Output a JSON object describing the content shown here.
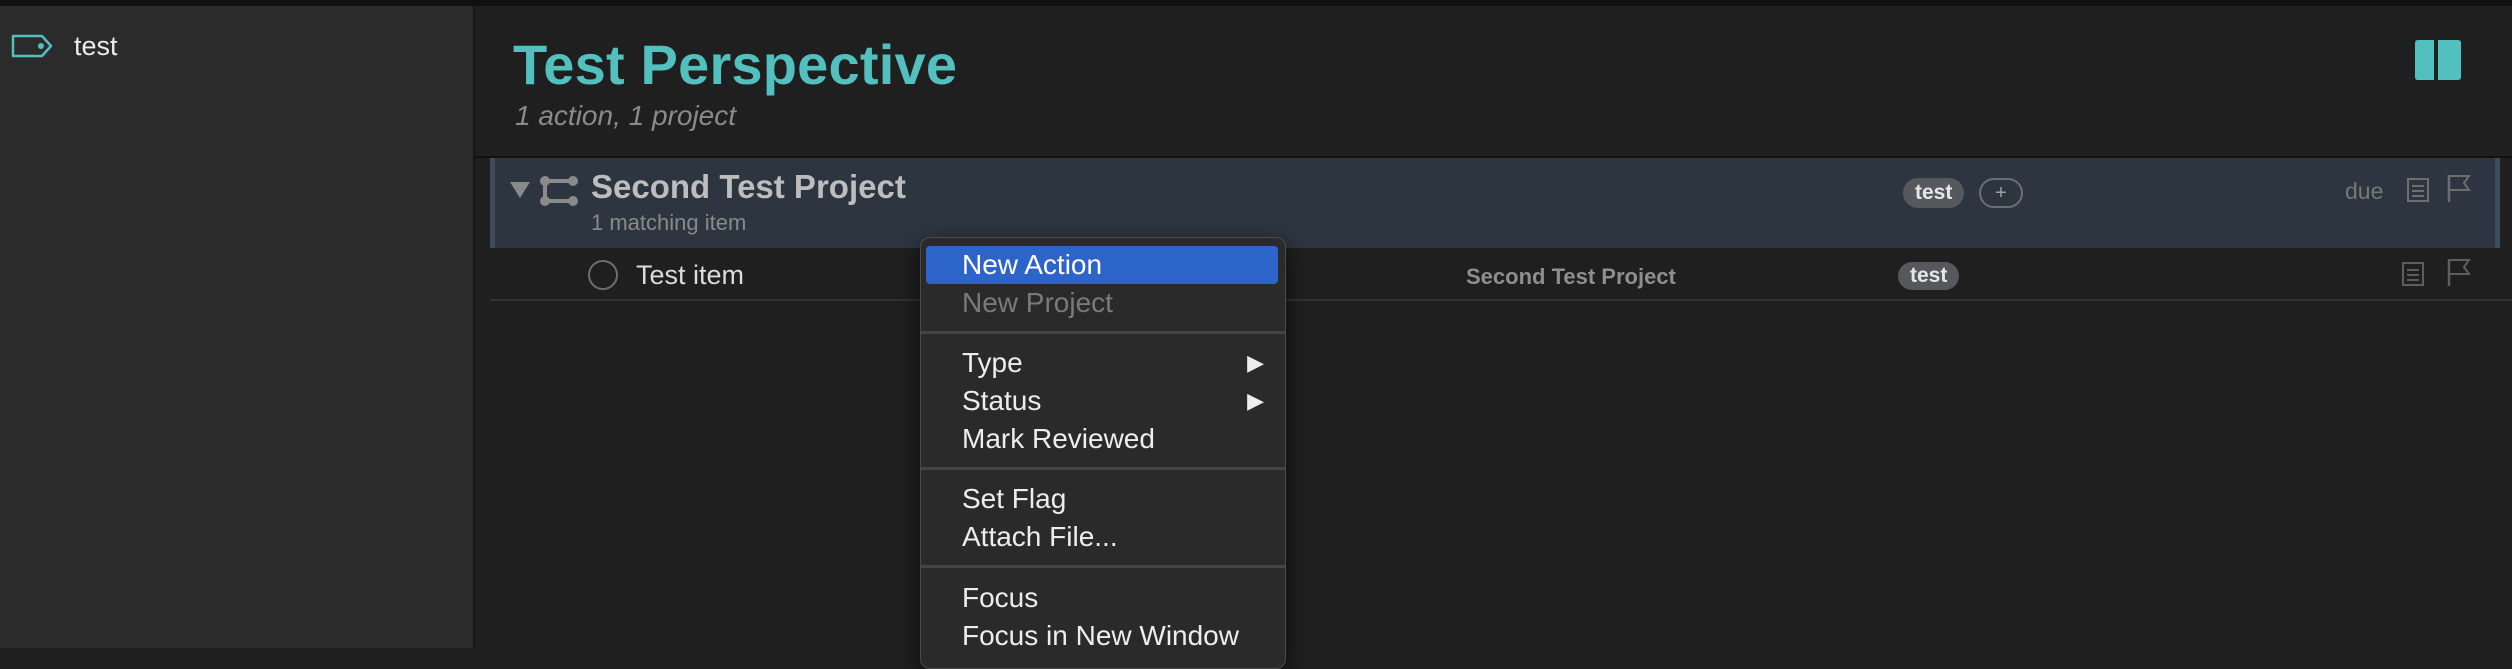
{
  "sidebar": {
    "items": [
      {
        "label": "test",
        "icon": "tag-icon"
      }
    ]
  },
  "header": {
    "title": "Test Perspective",
    "subtitle": "1 action, 1 project",
    "inspector_icon": "inspector-panel-icon"
  },
  "project": {
    "title": "Second Test Project",
    "subtitle": "1 matching item",
    "tag": "test",
    "add_tag": "+",
    "due_label": "due"
  },
  "action": {
    "title": "Test item",
    "project": "Second Test Project",
    "tag": "test"
  },
  "context_menu": {
    "items": [
      {
        "label": "New Action",
        "highlighted": true
      },
      {
        "label": "New Project",
        "disabled": true
      },
      {
        "label": "Type",
        "submenu": true
      },
      {
        "label": "Status",
        "submenu": true
      },
      {
        "label": "Mark Reviewed"
      },
      {
        "label": "Set Flag"
      },
      {
        "label": "Attach File..."
      },
      {
        "label": "Focus"
      },
      {
        "label": "Focus in New Window"
      }
    ],
    "submenu_arrow": "▶"
  },
  "colors": {
    "accent": "#52c0be",
    "highlight": "#2c64c9",
    "sidebar_bg": "#2b2b2b",
    "main_bg": "#1f1f1f",
    "project_row_bg": "#2c3540"
  }
}
